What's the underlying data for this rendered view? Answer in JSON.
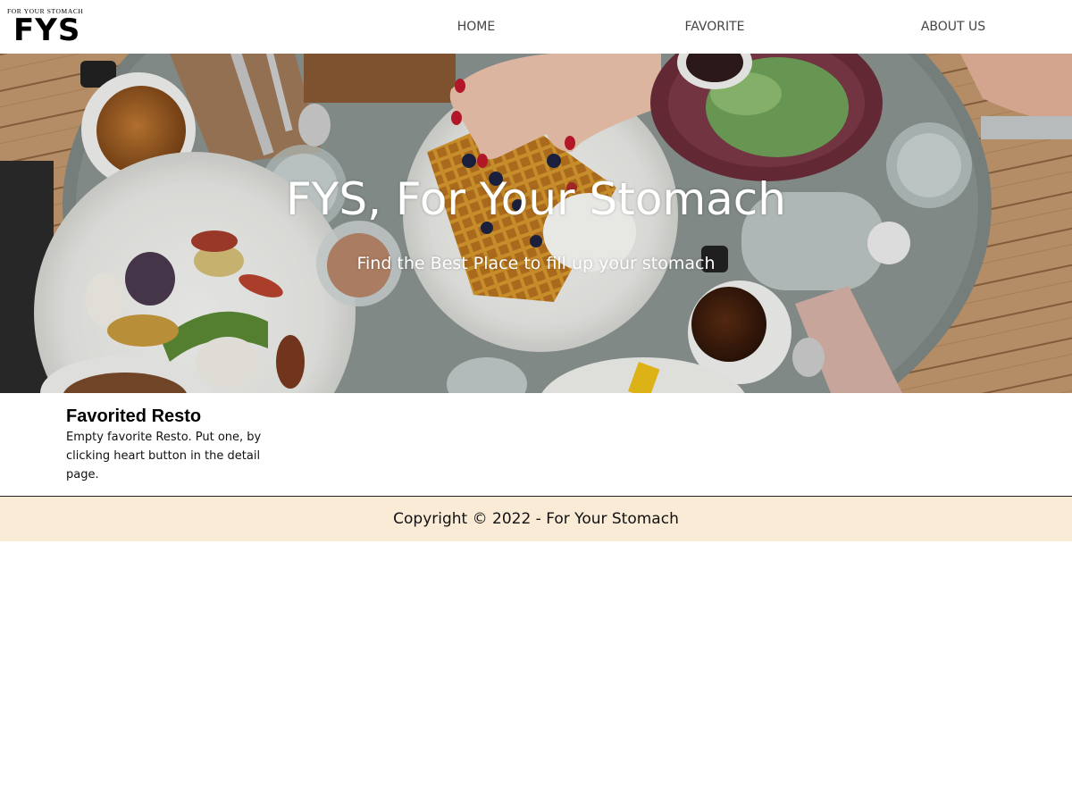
{
  "header": {
    "logo_tagline": "FOR YOUR STOMACH",
    "logo_text": "FYS",
    "nav": [
      {
        "label": "HOME"
      },
      {
        "label": "FAVORITE"
      },
      {
        "label": "ABOUT US"
      }
    ]
  },
  "hero": {
    "title": "FYS, For Your Stomach",
    "subtitle": "Find the Best Place to fill up your stomach"
  },
  "favorites": {
    "heading": "Favorited Resto",
    "empty_message": "Empty favorite Resto. Put one, by clicking heart button in the detail page."
  },
  "footer": {
    "copyright": "Copyright © 2022 - For Your Stomach"
  },
  "colors": {
    "footer_background": "#faebd7",
    "nav_text": "#444444",
    "hero_text": "#ffffff"
  }
}
